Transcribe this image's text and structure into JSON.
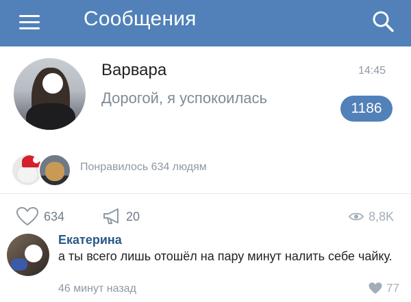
{
  "header": {
    "title": "Сообщения",
    "menu_icon": "hamburger-menu-icon",
    "search_icon": "search-icon",
    "bg_color": "#5181b8"
  },
  "dialog": {
    "name": "Варвара",
    "preview": "Дорогой, я успокоилась",
    "time": "14:45",
    "unread_count": "1186"
  },
  "likes": {
    "text": "Понравилось 634 людям"
  },
  "actions": {
    "like_count": "634",
    "share_count": "20",
    "view_count": "8,8K"
  },
  "comment": {
    "author": "Екатерина",
    "text": "а ты всего лишь отошёл на пару минут налить себе чайку.",
    "time": "46 минут назад",
    "like_count": "77"
  }
}
